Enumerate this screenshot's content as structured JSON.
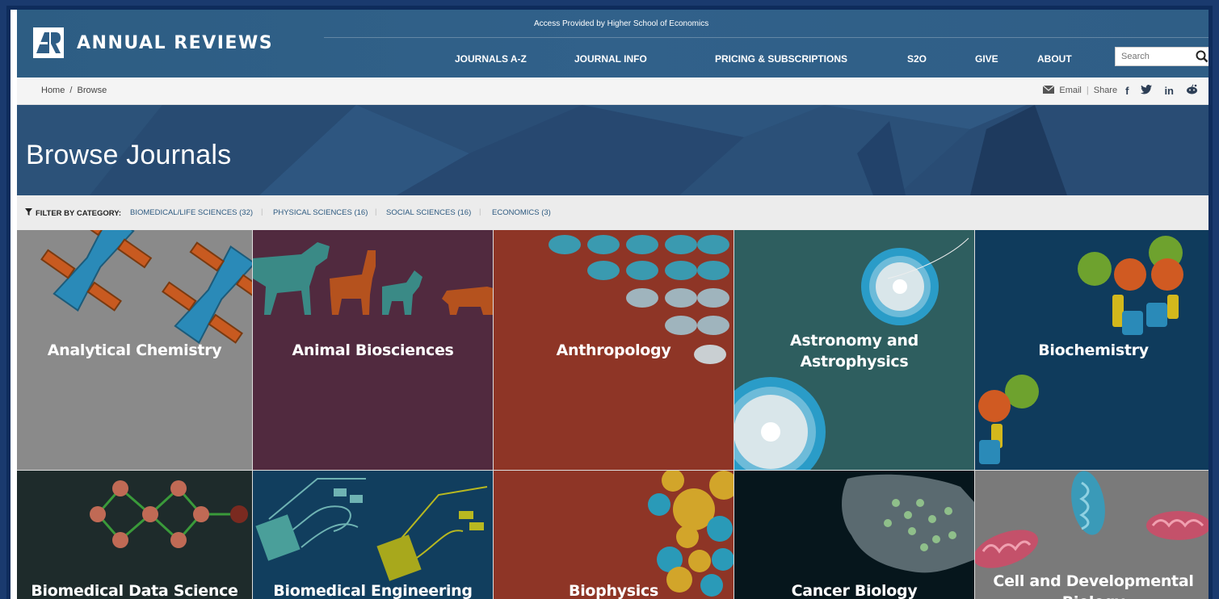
{
  "header": {
    "brand": "ANNUAL REVIEWS",
    "access_note": "Access Provided by Higher School of Economics",
    "nav": [
      "JOURNALS A-Z",
      "JOURNAL INFO",
      "PRICING & SUBSCRIPTIONS",
      "S2O",
      "GIVE",
      "ABOUT"
    ],
    "search_placeholder": "Search"
  },
  "breadcrumb": {
    "home": "Home",
    "separator": "/",
    "current": "Browse"
  },
  "share": {
    "email": "Email",
    "divider": "|",
    "share": "Share",
    "icons": [
      "facebook-icon",
      "twitter-icon",
      "linkedin-icon",
      "reddit-icon"
    ]
  },
  "hero": {
    "title": "Browse Journals"
  },
  "filter": {
    "label": "FILTER BY CATEGORY:",
    "categories": [
      "BIOMEDICAL/LIFE SCIENCES (32)",
      "PHYSICAL SCIENCES (16)",
      "SOCIAL SCIENCES (16)",
      "ECONOMICS (3)"
    ],
    "separator": "|"
  },
  "journals": [
    {
      "name": "Analytical Chemistry",
      "color": "#8a8a8a"
    },
    {
      "name": "Animal Biosciences",
      "color": "#512a3f"
    },
    {
      "name": "Anthropology",
      "color": "#8e3526"
    },
    {
      "name": "Astronomy and Astrophysics",
      "color": "#2e5e5f"
    },
    {
      "name": "Biochemistry",
      "color": "#0f3b5c"
    },
    {
      "name": "Biomedical Data Science",
      "color": "#1e2b2b"
    },
    {
      "name": "Biomedical Engineering",
      "color": "#113e5e"
    },
    {
      "name": "Biophysics",
      "color": "#8e3526"
    },
    {
      "name": "Cancer Biology",
      "color": "#06161c"
    },
    {
      "name": "Cell and Developmental Biology",
      "color": "#7a7a7a"
    }
  ],
  "colors": {
    "header_bg": "#2f5e86",
    "hero_bg": "#2a4f78",
    "frame": "#1a3a6e",
    "link": "#2d5a80"
  }
}
